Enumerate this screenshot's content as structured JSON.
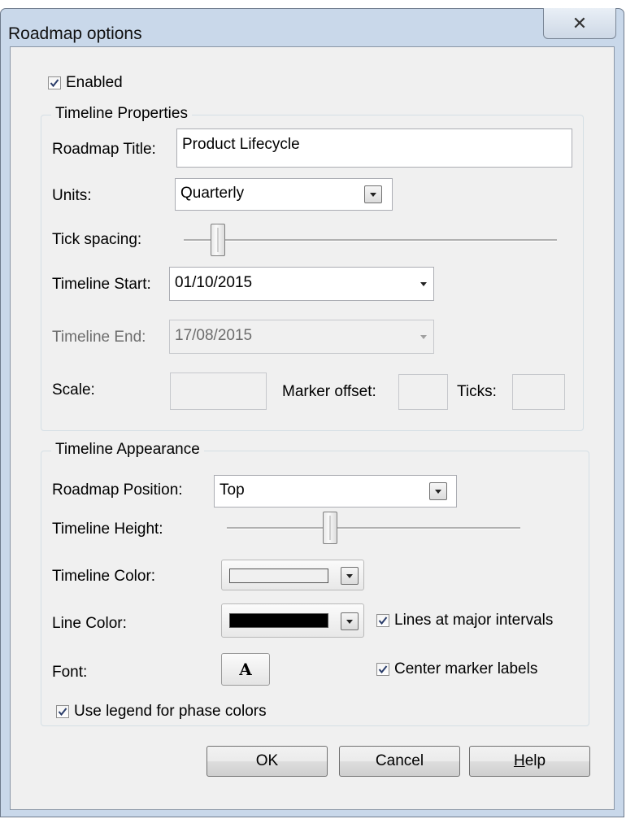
{
  "window": {
    "title": "Roadmap options",
    "close_glyph": "✕"
  },
  "enabled": {
    "label": "Enabled",
    "checked": true
  },
  "timeline_properties": {
    "legend": "Timeline Properties",
    "roadmap_title_label": "Roadmap Title:",
    "roadmap_title_value": "Product Lifecycle",
    "units_label": "Units:",
    "units_value": "Quarterly",
    "tick_spacing_label": "Tick spacing:",
    "timeline_start_label": "Timeline Start:",
    "timeline_start_value": "01/10/2015",
    "timeline_end_label": "Timeline End:",
    "timeline_end_value": "17/08/2015",
    "scale_label": "Scale:",
    "scale_value": "",
    "marker_offset_label": "Marker offset:",
    "marker_offset_value": "",
    "ticks_label": "Ticks:",
    "ticks_value": ""
  },
  "timeline_appearance": {
    "legend": "Timeline Appearance",
    "position_label": "Roadmap Position:",
    "position_value": "Top",
    "height_label": "Timeline Height:",
    "timeline_color_label": "Timeline Color:",
    "timeline_color": "#f0f0f0",
    "line_color_label": "Line Color:",
    "line_color": "#000000",
    "lines_major_label": "Lines at major intervals",
    "lines_major_checked": true,
    "font_label": "Font:",
    "font_button_glyph": "A",
    "center_marker_label": "Center marker labels",
    "center_marker_checked": true,
    "use_legend_label": "Use legend for phase colors",
    "use_legend_checked": true
  },
  "buttons": {
    "ok": "OK",
    "cancel": "Cancel",
    "help_prefix": "",
    "help_underline": "H",
    "help_rest": "elp"
  }
}
